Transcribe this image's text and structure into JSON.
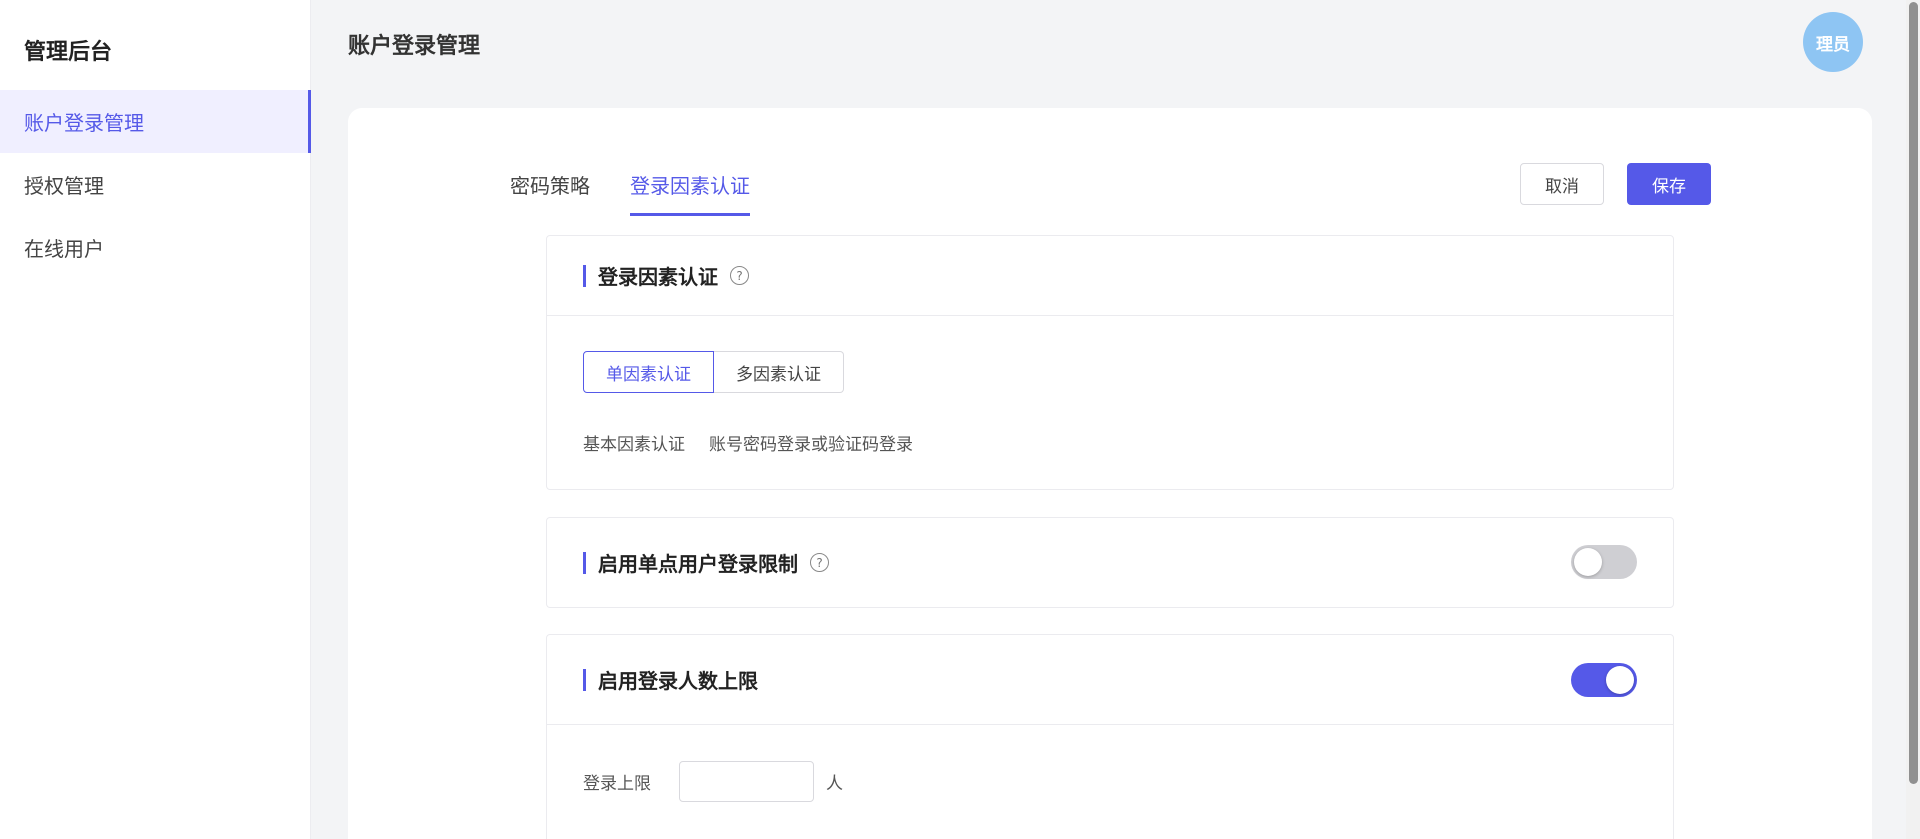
{
  "sidebar": {
    "brand": "管理后台",
    "items": [
      {
        "label": "账户登录管理",
        "active": true
      },
      {
        "label": "授权管理",
        "active": false
      },
      {
        "label": "在线用户",
        "active": false
      }
    ]
  },
  "header": {
    "title": "账户登录管理",
    "avatar_text": "理员"
  },
  "tabs": [
    {
      "label": "密码策略",
      "active": false
    },
    {
      "label": "登录因素认证",
      "active": true
    }
  ],
  "actions": {
    "cancel_label": "取消",
    "save_label": "保存"
  },
  "section_auth": {
    "title": "登录因素认证",
    "help_icon": "question-circle-icon",
    "segments": [
      {
        "label": "单因素认证",
        "selected": true
      },
      {
        "label": "多因素认证",
        "selected": false
      }
    ],
    "description_label": "基本因素认证",
    "description_value": "账号密码登录或验证码登录"
  },
  "section_single_login": {
    "title": "启用单点用户登录限制",
    "help_icon": "question-circle-icon",
    "enabled": false
  },
  "section_login_limit": {
    "title": "启用登录人数上限",
    "enabled": true,
    "field_label": "登录上限",
    "field_value": "",
    "unit": "人"
  },
  "colors": {
    "accent": "#5559e8",
    "avatar": "#8ec5f3",
    "toggle_off": "#cfcfd3"
  }
}
